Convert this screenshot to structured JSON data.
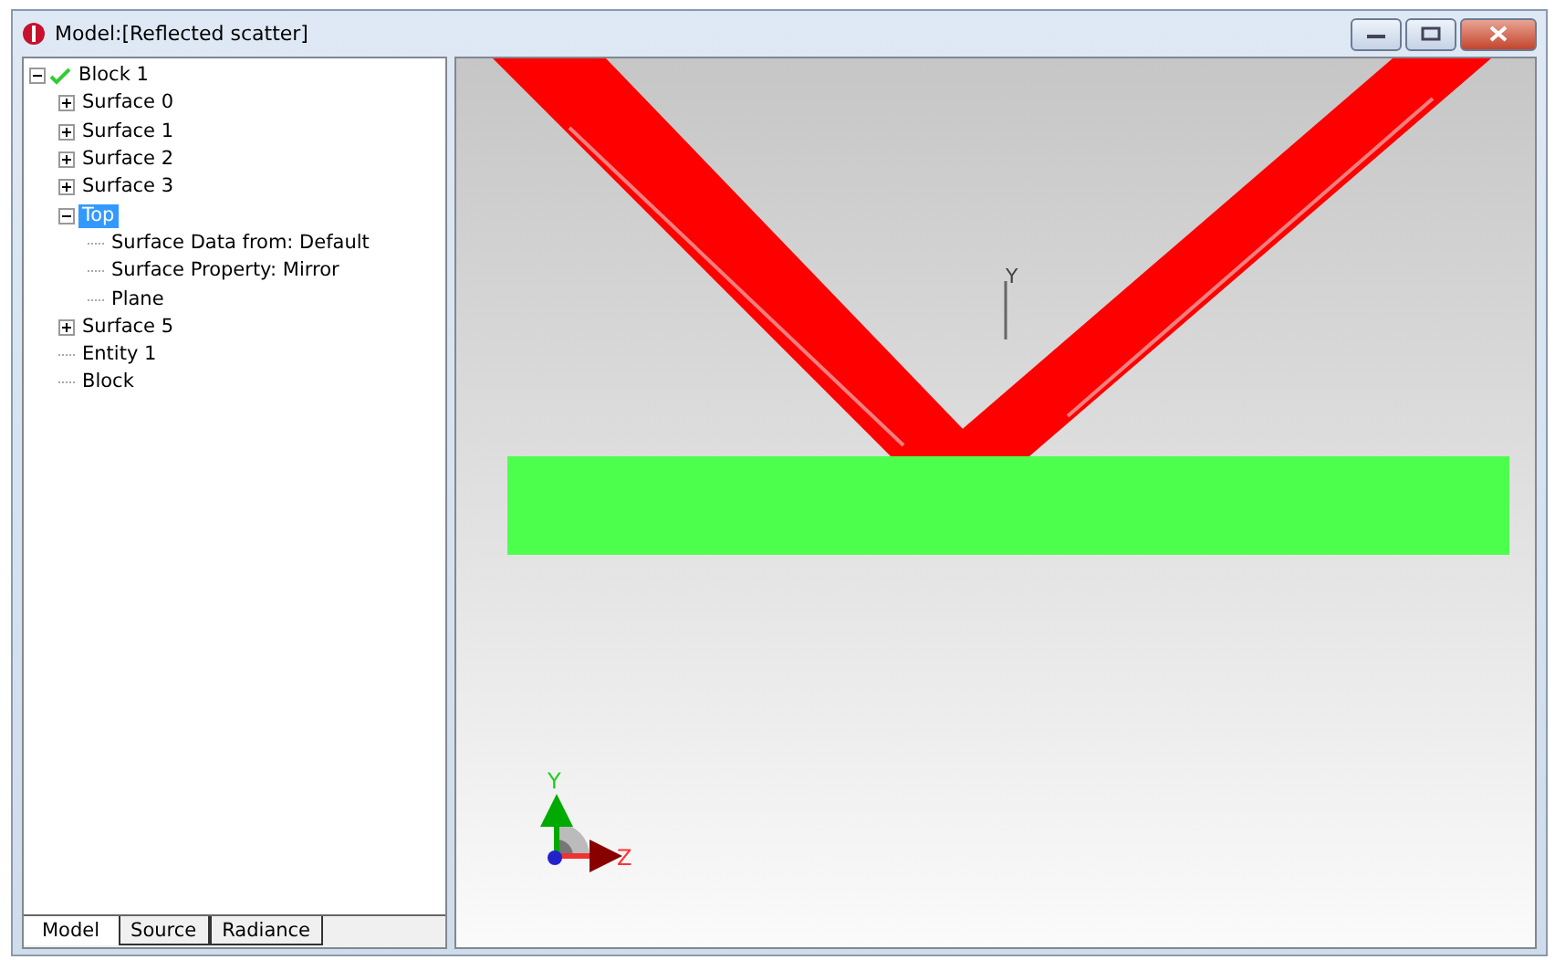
{
  "window": {
    "title": "Model:[Reflected scatter]"
  },
  "tree": [
    {
      "label": "Block 1",
      "checked": true,
      "expanded": true,
      "selected": false,
      "children": [
        {
          "label": "Surface 0",
          "expanded": false,
          "selected": false
        },
        {
          "label": "Surface 1",
          "expanded": false,
          "selected": false
        },
        {
          "label": "Surface 2",
          "expanded": false,
          "selected": false
        },
        {
          "label": "Surface 3",
          "expanded": false,
          "selected": false
        },
        {
          "label": "Top",
          "expanded": true,
          "selected": true,
          "children": [
            {
              "label": "Surface Data from: Default",
              "selected": false
            },
            {
              "label": "Surface Property: Mirror",
              "selected": false
            },
            {
              "label": "Plane",
              "selected": false
            }
          ]
        },
        {
          "label": "Surface 5",
          "expanded": false,
          "selected": false
        },
        {
          "label": "Entity 1",
          "selected": false
        },
        {
          "label": "Block",
          "selected": false
        }
      ]
    }
  ],
  "tabs": [
    {
      "label": "Model",
      "selected": true
    },
    {
      "label": "Source",
      "selected": false
    },
    {
      "label": "Radiance",
      "selected": false
    }
  ],
  "viewport": {
    "y_marker_label": "Y",
    "triad": {
      "y_label": "Y",
      "z_label": "Z"
    }
  }
}
